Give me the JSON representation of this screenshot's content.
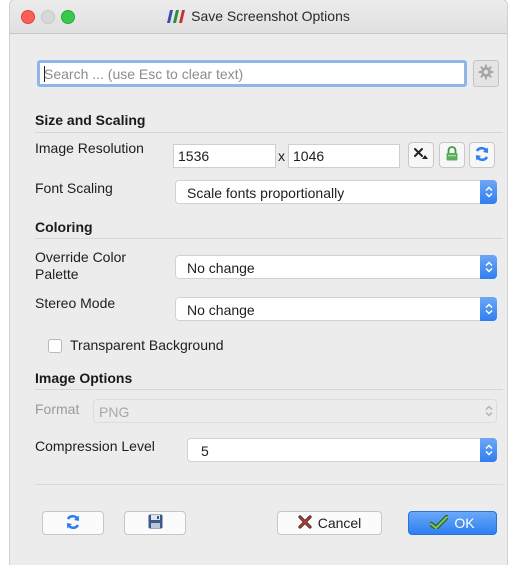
{
  "window": {
    "title": "Save Screenshot Options",
    "icons": {
      "app": "paraview-logo-icon"
    }
  },
  "search": {
    "placeholder": "Search ... (use Esc to clear text)",
    "value": "",
    "icon": "gear-icon"
  },
  "size_and_scaling": {
    "heading": "Size and Scaling",
    "image_resolution_label": "Image Resolution",
    "width": "1536",
    "separator": "x",
    "height": "1046",
    "buttons": [
      "reset-resolution-icon",
      "lock-aspect-icon",
      "refresh-icon"
    ],
    "font_scaling_label": "Font Scaling",
    "font_scaling_value": "Scale fonts proportionally"
  },
  "coloring": {
    "heading": "Coloring",
    "override_palette_label_line1": "Override Color",
    "override_palette_label_line2": "Palette",
    "override_palette_value": "No change",
    "stereo_label": "Stereo Mode",
    "stereo_value": "No change",
    "transparent_label": "Transparent Background",
    "transparent_checked": false
  },
  "image_options": {
    "heading": "Image Options",
    "format_label": "Format",
    "format_value": "PNG",
    "compression_label": "Compression Level",
    "compression_value": "5"
  },
  "footer": {
    "reset_icon": "refresh-icon",
    "save_icon": "floppy-disk-icon",
    "cancel_label": "Cancel",
    "ok_label": "OK"
  },
  "colors": {
    "accent": "#2f7ef0",
    "close_light": "#fc5f57",
    "max_light": "#36c94a",
    "cancel_x": "#c0392b"
  }
}
